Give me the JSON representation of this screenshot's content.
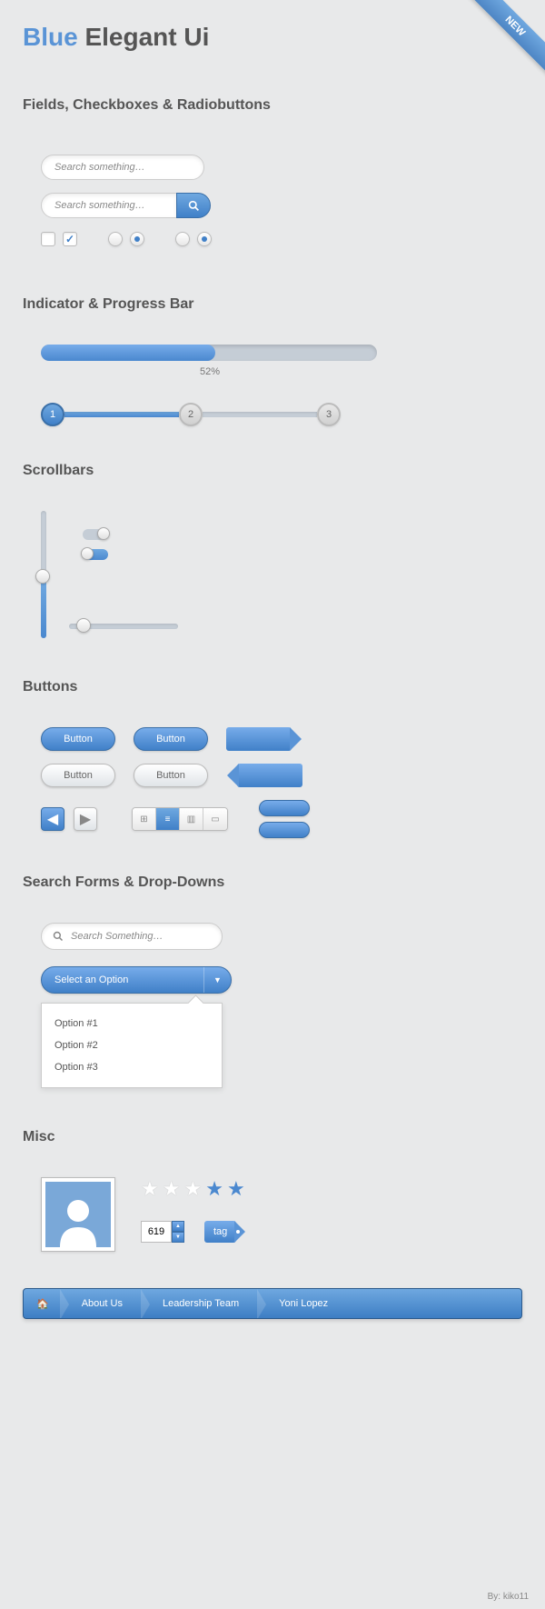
{
  "ribbon": "NEW",
  "title": {
    "blue": "Blue",
    "rest": "Elegant Ui"
  },
  "sections": {
    "fields": "Fields, Checkboxes & Radiobuttons",
    "progress": "Indicator & Progress Bar",
    "scrollbars": "Scrollbars",
    "buttons": "Buttons",
    "searchdd": "Search Forms & Drop-Downs",
    "misc": "Misc"
  },
  "fields": {
    "search1": "Search something…",
    "search2": "Search something…"
  },
  "progress": {
    "percent": 52,
    "label": "52%",
    "steps": [
      "1",
      "2",
      "3"
    ]
  },
  "buttons": {
    "label": "Button"
  },
  "searchdd": {
    "placeholder": "Search Something…",
    "select_label": "Select an Option",
    "options": [
      "Option #1",
      "Option #2",
      "Option #3"
    ]
  },
  "misc": {
    "stepper_value": "619",
    "tag_label": "tag"
  },
  "breadcrumb": {
    "items": [
      "About Us",
      "Leadership Team",
      "Yoni Lopez"
    ]
  },
  "credit": "By: kiko11"
}
